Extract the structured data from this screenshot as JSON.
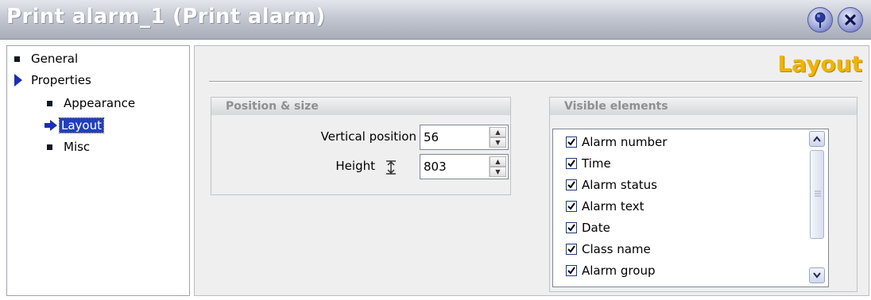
{
  "window": {
    "title": "Print alarm_1 (Print alarm)",
    "help_icon": "pin-help-icon",
    "close_icon": "close-icon"
  },
  "tree": {
    "items": [
      {
        "label": "General",
        "icon": "square-bullet-icon"
      },
      {
        "label": "Properties",
        "icon": "expand-triangle-icon"
      },
      {
        "label": "Appearance",
        "icon": "square-bullet-icon"
      },
      {
        "label": "Layout",
        "icon": "arrow-right-icon",
        "selected": true
      },
      {
        "label": "Misc",
        "icon": "square-bullet-icon"
      }
    ]
  },
  "panel": {
    "title": "Layout",
    "position_group": {
      "heading": "Position & size",
      "vertical_position_label": "Vertical position",
      "vertical_position_value": "56",
      "height_label": "Height",
      "height_value": "803"
    },
    "visible_group": {
      "heading": "Visible elements",
      "items": [
        {
          "label": "Alarm number",
          "checked": true
        },
        {
          "label": "Time",
          "checked": true
        },
        {
          "label": "Alarm status",
          "checked": true
        },
        {
          "label": "Alarm text",
          "checked": true
        },
        {
          "label": "Date",
          "checked": true
        },
        {
          "label": "Class name",
          "checked": true
        },
        {
          "label": "Alarm group",
          "checked": true
        }
      ]
    }
  },
  "colors": {
    "accent_title": "#f0b400",
    "selection": "#1f3fc0"
  }
}
